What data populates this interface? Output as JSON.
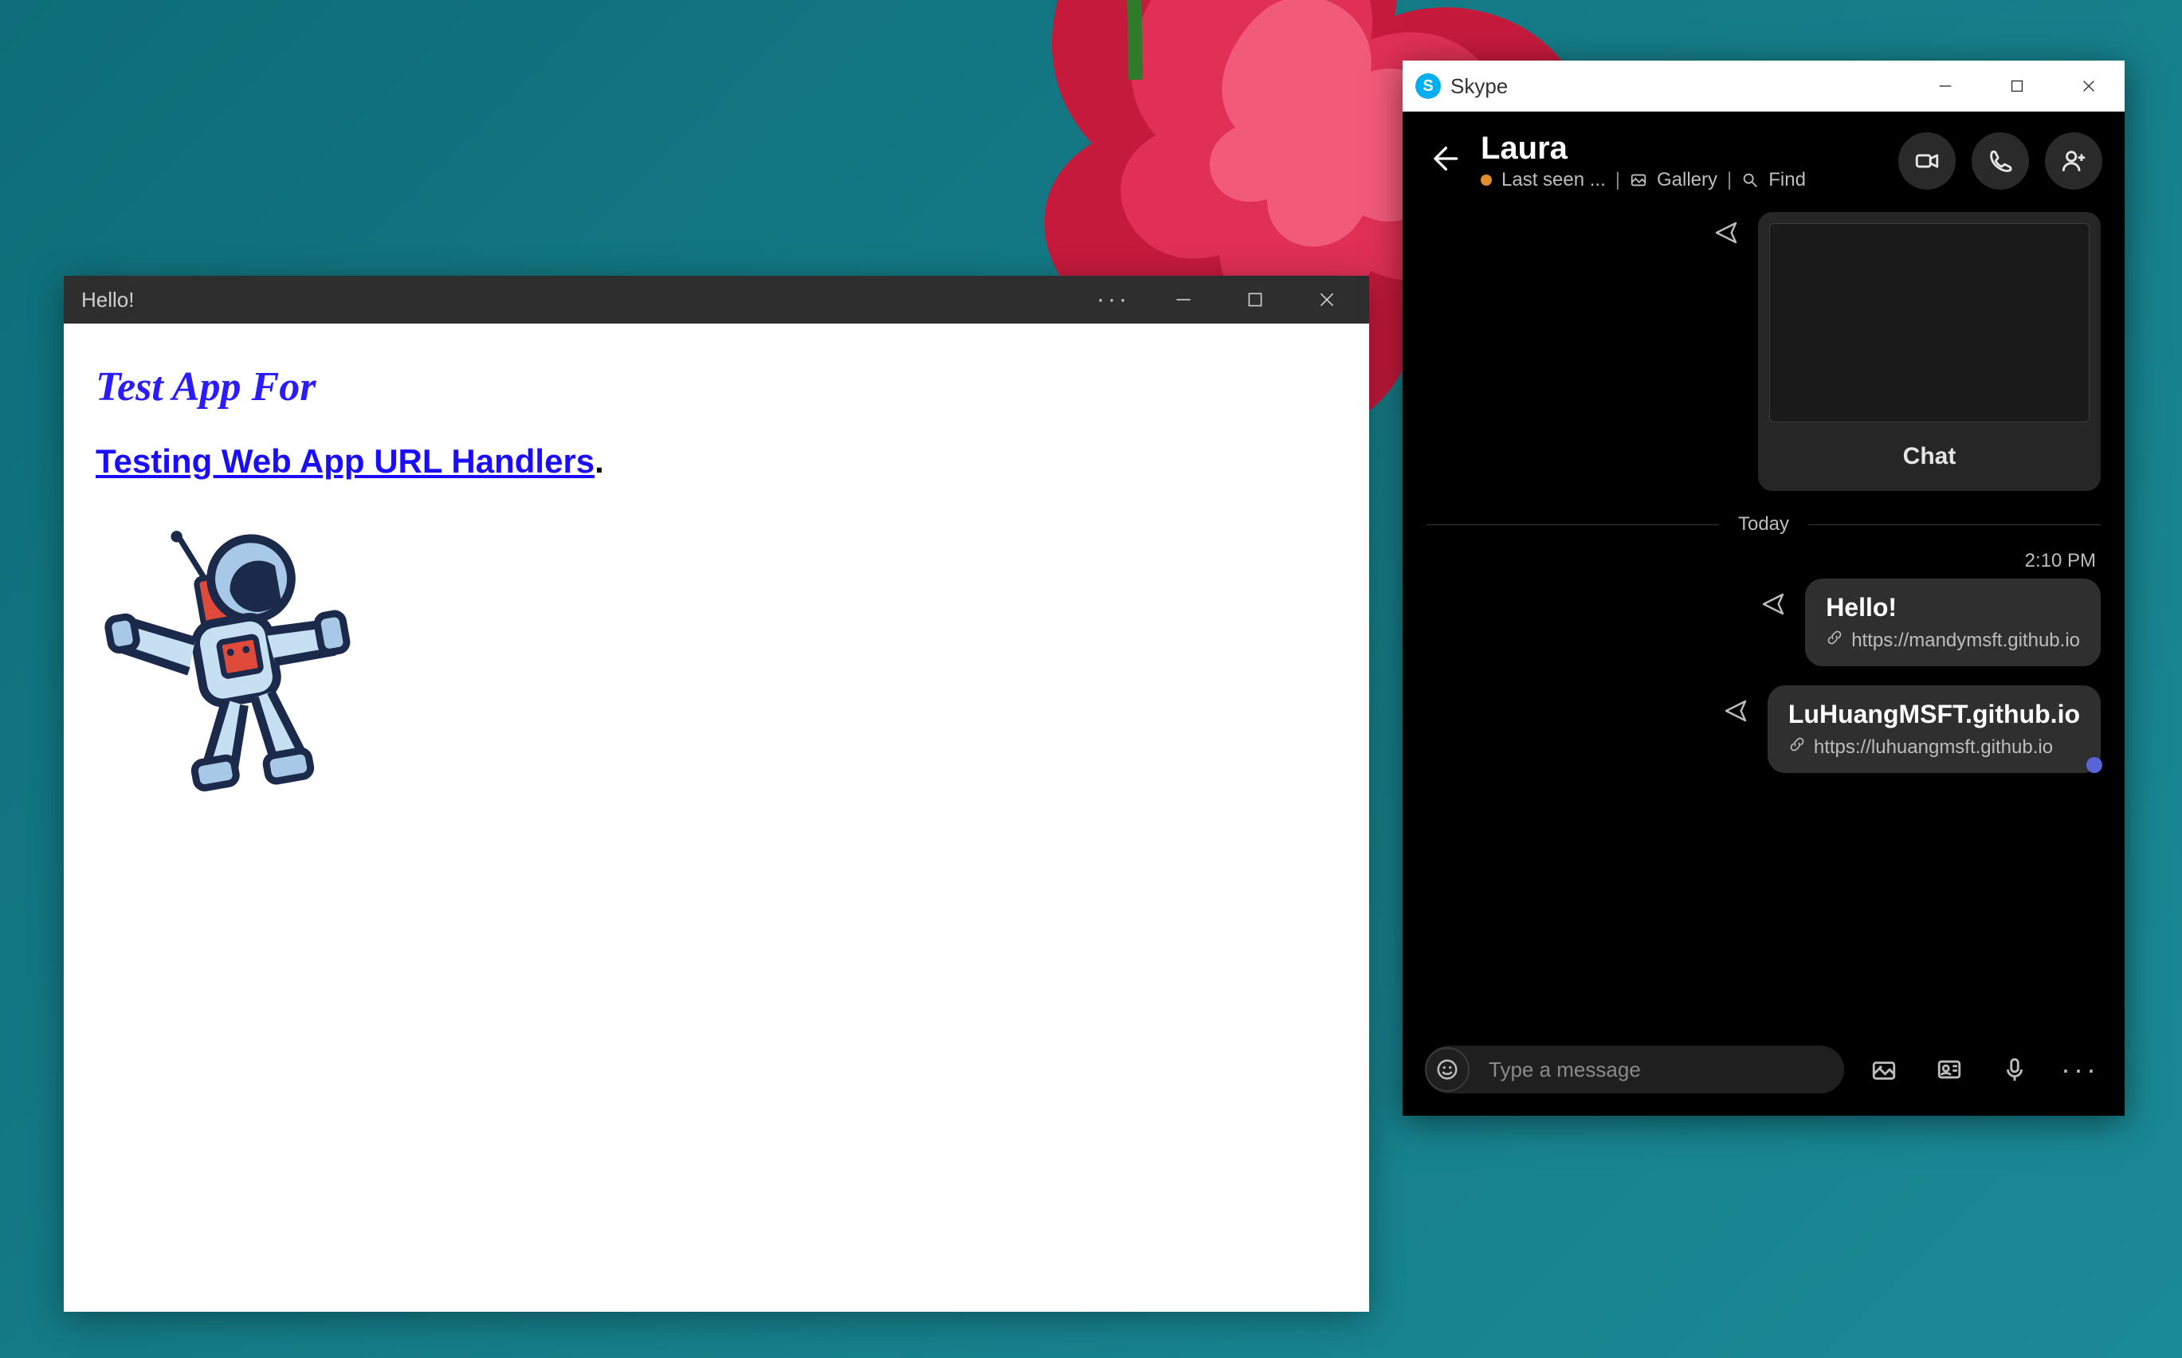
{
  "appWindow": {
    "title": "Hello!",
    "heading": "Test App For",
    "linkText": "Testing Web App URL Handlers",
    "period": "."
  },
  "skype": {
    "appTitle": "Skype",
    "contactName": "Laura",
    "lastSeen": "Last seen ...",
    "gallery": "Gallery",
    "find": "Find",
    "shareCard": {
      "chatLabel": "Chat"
    },
    "dayLabel": "Today",
    "timeStamp": "2:10 PM",
    "messages": [
      {
        "title": "Hello!",
        "url": "https://mandymsft.github.io"
      },
      {
        "title": "LuHuangMSFT.github.io",
        "url": "https://luhuangmsft.github.io"
      }
    ],
    "compose": {
      "placeholder": "Type a message"
    }
  }
}
